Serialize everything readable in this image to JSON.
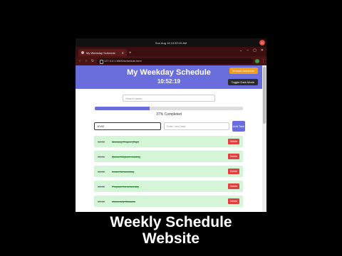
{
  "os_bar": {
    "datetime": "Sun Aug 18  10:52:19 AM",
    "power_icon": "power-icon"
  },
  "browser": {
    "tab_title": "My Weekday Schedule",
    "new_tab": "+",
    "window_controls": [
      "⌄",
      "–",
      "▢",
      "✕"
    ],
    "nav": [
      "‹",
      "›",
      "↻"
    ],
    "url": "127.0.0.1:5500/schedule.html",
    "menu": "⋮"
  },
  "app": {
    "title": "My Weekday Schedule",
    "clock": "10:52:19",
    "default_button": "Default Schedule",
    "dark_button": "Toggle Dark Mode",
    "search_placeholder": "Search tasks...",
    "progress": {
      "percent": 37,
      "text": "37% Completed",
      "color": "#6a6ddc"
    },
    "time_value": "10:52",
    "task_placeholder": "Enter new task",
    "add_button": "Add Task",
    "tasks": [
      {
        "time": "06:30",
        "name": "Morning Prayer (Fajr)",
        "delete": "Delete"
      },
      {
        "time": "06:40",
        "name": "Quran Mojood reading",
        "delete": "Delete"
      },
      {
        "time": "06:50",
        "name": "Learn Networking",
        "delete": "Delete"
      },
      {
        "time": "08:00",
        "name": "Prepare for university",
        "delete": "Delete"
      },
      {
        "time": "08:30",
        "name": "University Classes",
        "delete": "Delete"
      }
    ]
  },
  "caption": {
    "line1": "Weekly Schedule",
    "line2": "Website"
  }
}
